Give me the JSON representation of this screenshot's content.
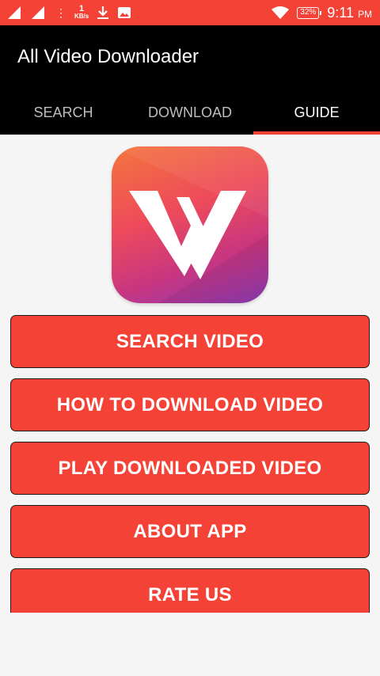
{
  "status_bar": {
    "net_speed_value": "1",
    "net_speed_unit": "KB/s",
    "battery": "32%",
    "time": "9:11",
    "ampm": "PM"
  },
  "app": {
    "title": "All Video Downloader"
  },
  "tabs": [
    {
      "label": "SEARCH",
      "active": false
    },
    {
      "label": "DOWNLOAD",
      "active": false
    },
    {
      "label": "GUIDE",
      "active": true
    }
  ],
  "menu": {
    "items": [
      {
        "label": "SEARCH VIDEO"
      },
      {
        "label": "HOW TO DOWNLOAD VIDEO"
      },
      {
        "label": "PLAY DOWNLOADED VIDEO"
      },
      {
        "label": "ABOUT APP"
      },
      {
        "label": "RATE US"
      }
    ]
  },
  "colors": {
    "accent": "#f44336",
    "app_bar": "#000000"
  },
  "icons": [
    "signal-icon",
    "download-icon",
    "image-icon",
    "wifi-icon",
    "battery-icon",
    "app-logo-icon"
  ]
}
